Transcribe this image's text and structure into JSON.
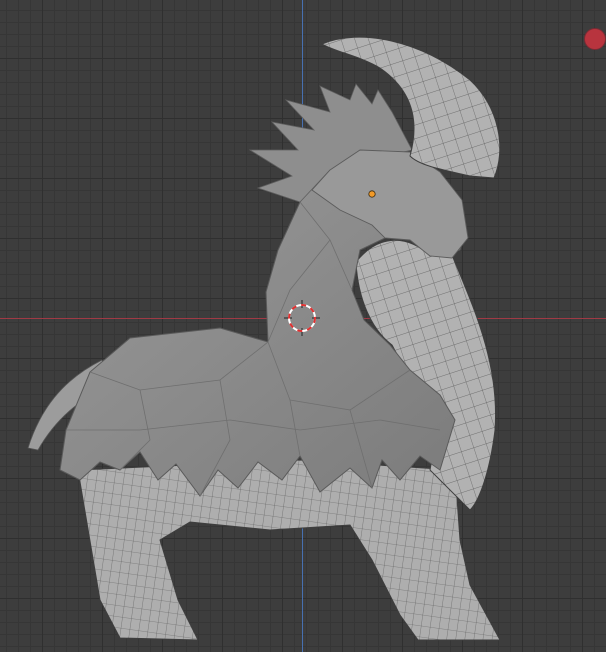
{
  "viewport": {
    "background": "#3d3d3d",
    "grid_major_color": "#2f2f2f",
    "grid_minor_color": "#363636",
    "x_axis_color": "#a03a45",
    "z_axis_color": "#4770b0"
  },
  "model": {
    "body_fill": "#8a8a8a",
    "light_fill": "#a9a9a9",
    "wire_color": "#4a4a4a"
  },
  "origin_dot_color": "#f29a28",
  "cursor": {
    "ring_red": "#e03030",
    "ring_white": "#ffffff"
  },
  "record_button_color": "#b8343e",
  "icons": [
    "3d-cursor-icon",
    "origin-icon",
    "record-icon"
  ]
}
